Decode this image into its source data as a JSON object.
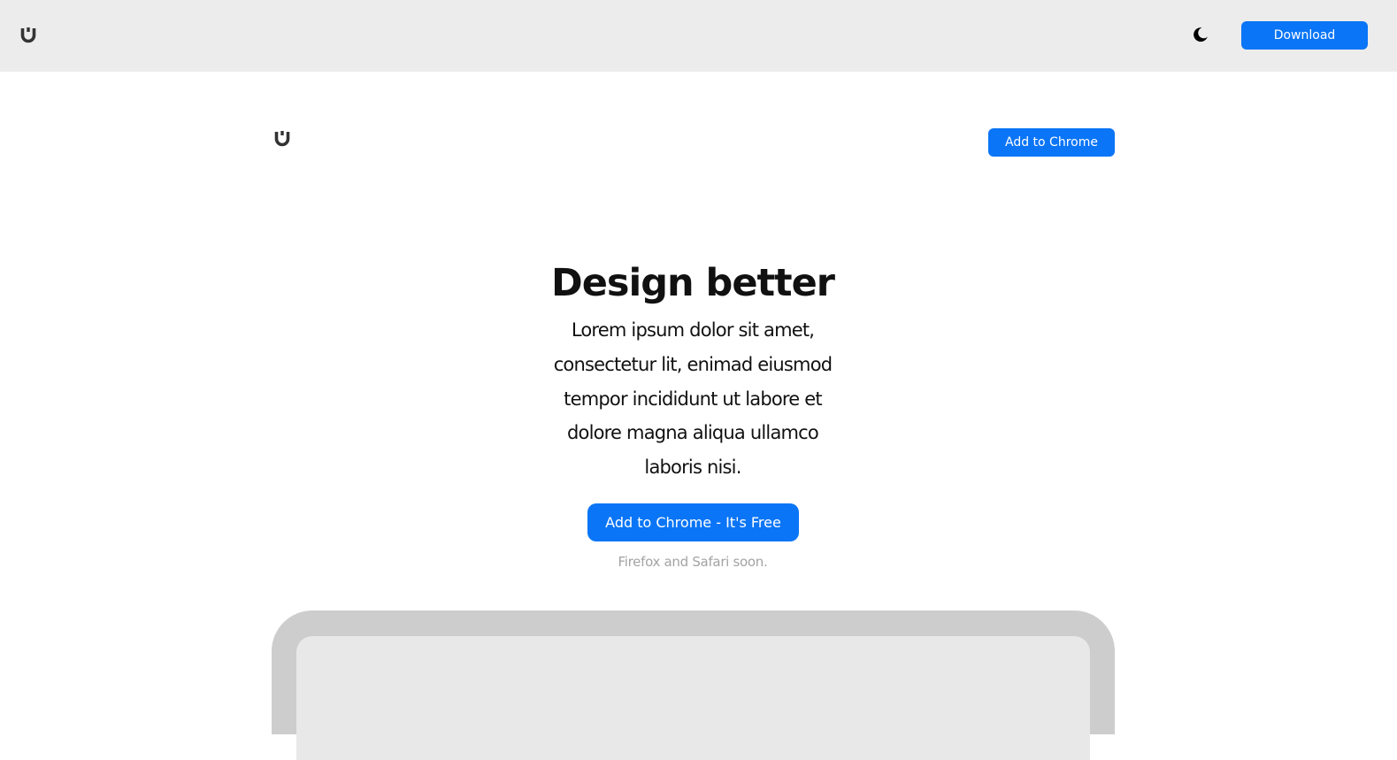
{
  "header": {
    "logo_icon": "magnet-logo-icon",
    "theme_icon": "moon-icon",
    "download_label": "Download"
  },
  "hero_nav": {
    "logo_icon": "magnet-logo-icon",
    "add_to_chrome_label": "Add to Chrome"
  },
  "hero": {
    "title": "Design better",
    "text": "Lorem ipsum dolor sit amet, consectetur lit, enimad eiusmod tempor incididunt ut labore et dolore magna aliqua ullamco laboris nisi.",
    "cta_label": "Add to Chrome - It's Free",
    "note": "Firefox and Safari soon."
  },
  "colors": {
    "accent": "#0a75f6",
    "topbar_bg": "#ececec",
    "device_frame": "#cdcdcd",
    "device_screen": "#e8e8e8",
    "muted_text": "#a3a3a3"
  }
}
